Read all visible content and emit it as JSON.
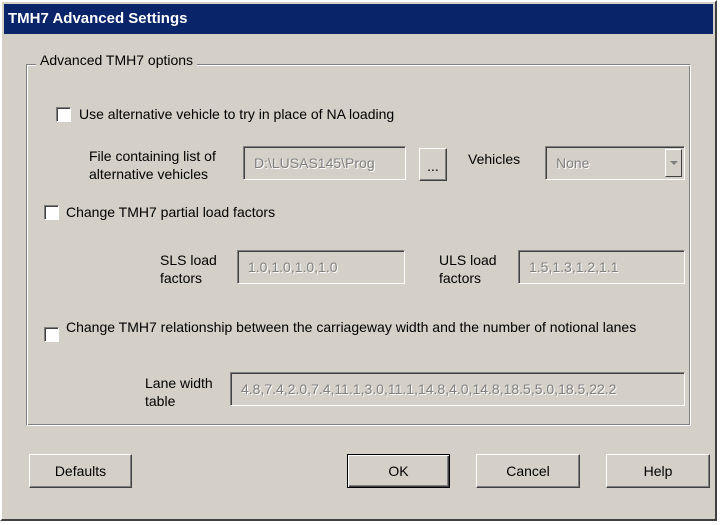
{
  "window": {
    "title": "TMH7 Advanced Settings"
  },
  "group": {
    "legend": "Advanced TMH7 options"
  },
  "alt_vehicle": {
    "checkbox_label": "Use alternative vehicle to try in place of NA loading",
    "checked": false,
    "file_label": "File containing list of alternative vehicles",
    "file_value": "D:\\LUSAS145\\Prog",
    "browse_label": "...",
    "vehicles_label": "Vehicles",
    "vehicles_value": "None"
  },
  "partial_load": {
    "checkbox_label": "Change TMH7 partial load factors",
    "checked": false,
    "sls_label": "SLS load factors",
    "sls_value": "1.0,1.0,1.0,1.0",
    "uls_label": "ULS load factors",
    "uls_value": "1.5,1.3,1.2,1.1"
  },
  "lanes": {
    "checkbox_label": "Change TMH7 relationship between the carriageway width and the number of notional lanes",
    "checked": false,
    "lane_width_label": "Lane width table",
    "lane_width_value": "4.8,7.4,2.0,7.4,11.1,3.0,11.1,14.8,4.0,14.8,18.5,5.0,18.5,22.2"
  },
  "buttons": {
    "defaults": "Defaults",
    "ok": "OK",
    "cancel": "Cancel",
    "help": "Help"
  }
}
